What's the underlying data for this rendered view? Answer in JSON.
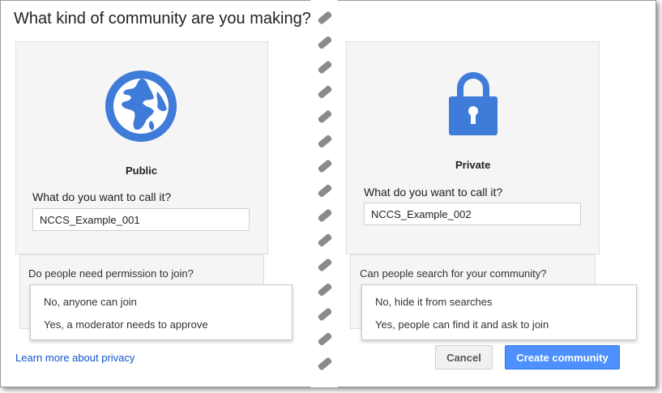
{
  "title": "What kind of community are you making?",
  "public": {
    "label": "Public",
    "name_question": "What do you want to call it?",
    "name_value": "NCCS_Example_001",
    "permission_question": "Do people need permission to join?",
    "options": [
      "No, anyone can join",
      "Yes, a moderator needs to approve"
    ],
    "icon": "globe-icon",
    "accent_color": "#3f7bd9"
  },
  "private": {
    "label": "Private",
    "name_question": "What do you want to call it?",
    "name_value": "NCCS_Example_002",
    "search_question": "Can people search for your community?",
    "options": [
      "No, hide it from searches",
      "Yes, people can find it and ask to join"
    ],
    "icon": "lock-icon",
    "accent_color": "#3f7bd9"
  },
  "footer": {
    "learn_more": "Learn more about privacy",
    "cancel_label": "Cancel",
    "create_label": "Create community",
    "link_color": "#1155cc",
    "primary_button_color": "#4d90fe"
  }
}
